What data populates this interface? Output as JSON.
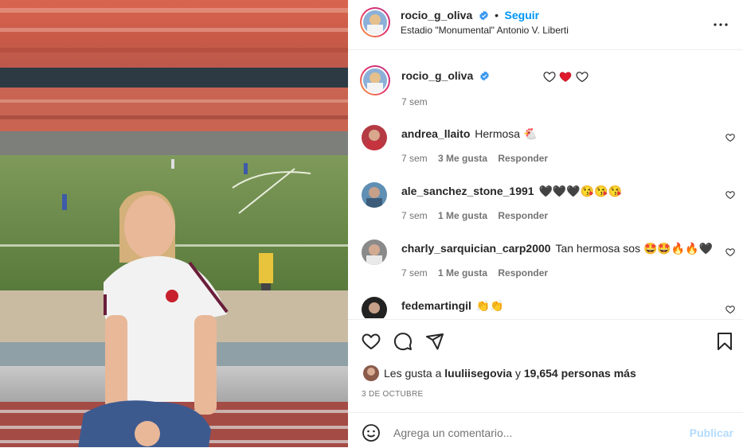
{
  "post": {
    "author": "rocio_g_oliva",
    "follow_label": "Seguir",
    "separator": "•",
    "location": "Estadio \"Monumental\" Antonio V. Liberti"
  },
  "caption": {
    "author": "rocio_g_oliva",
    "time": "7 sem"
  },
  "comments": [
    {
      "user": "andrea_llaito",
      "text": "Hermosa 🐔",
      "time": "7 sem",
      "likes": "3 Me gusta",
      "reply": "Responder"
    },
    {
      "user": "ale_sanchez_stone_1991",
      "text": "🖤🖤🖤😘😘😘",
      "time": "7 sem",
      "likes": "1 Me gusta",
      "reply": "Responder"
    },
    {
      "user": "charly_sarquician_carp2000",
      "text": "Tan hermosa sos 🤩🤩🔥🔥🖤",
      "time": "7 sem",
      "likes": "1 Me gusta",
      "reply": "Responder"
    },
    {
      "user": "fedemartingil",
      "text": "👏👏",
      "time": "",
      "likes": "",
      "reply": ""
    }
  ],
  "likes": {
    "prefix": "Les gusta a ",
    "user": "luuliisegovia",
    "middle": " y ",
    "count": "19,654 personas más"
  },
  "date": "3 DE OCTUBRE",
  "add_comment": {
    "placeholder": "Agrega un comentario...",
    "publish": "Publicar"
  },
  "icons": {
    "more": "more-icon",
    "heart": "heart-icon",
    "comment": "comment-icon",
    "share": "share-icon",
    "save": "save-icon",
    "emoji": "emoji-icon",
    "verified": "verified-icon"
  },
  "colors": {
    "link": "#0095f6",
    "verified": "#3897f0",
    "publish_disabled": "#b3dbff"
  }
}
